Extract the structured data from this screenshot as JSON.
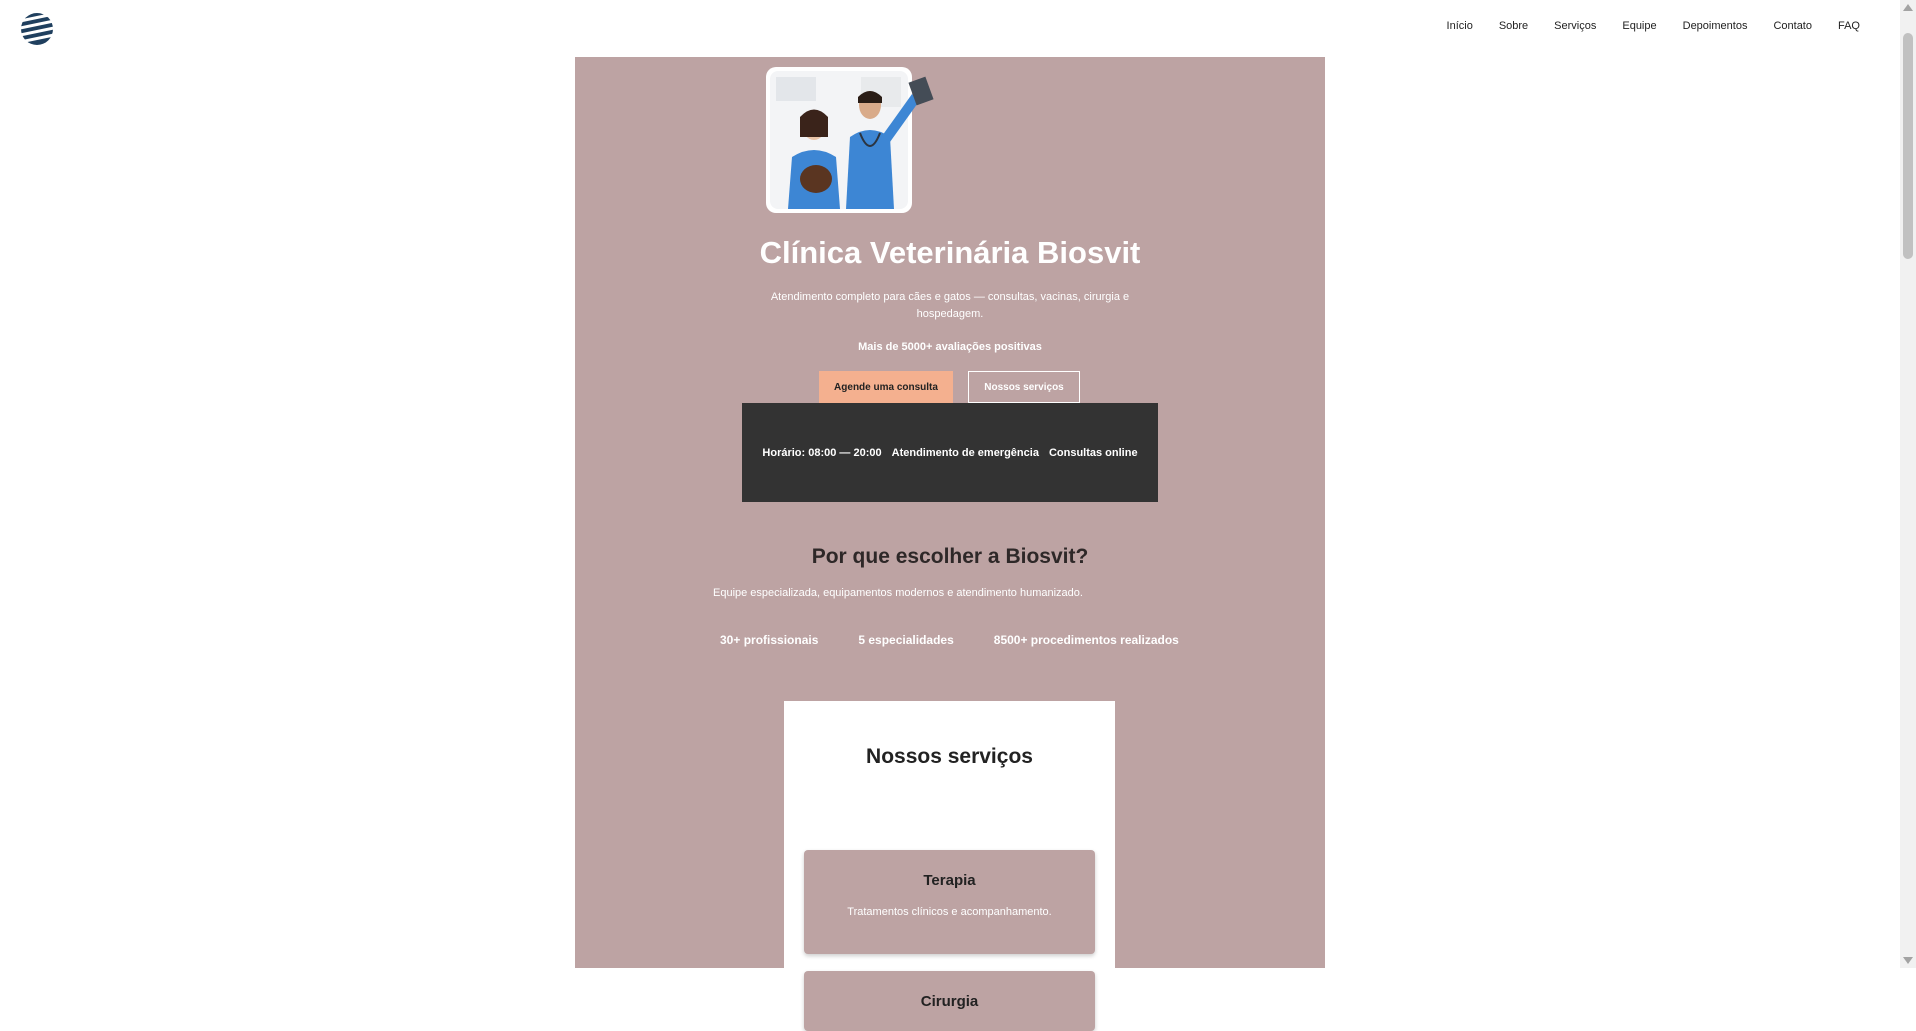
{
  "nav": {
    "items": [
      "Início",
      "Sobre",
      "Serviços",
      "Equipe",
      "Depoimentos",
      "Contato",
      "FAQ"
    ]
  },
  "logo": {
    "icon": "striped-globe-icon",
    "colors": [
      "#1f3f5e",
      "#ffffff"
    ]
  },
  "hero": {
    "title": "Clínica Veterinária Biosvit",
    "subtitle": "Atendimento completo para cães e gatos — consultas, vacinas, cirurgia e hospedagem.",
    "rating": "Mais de 5000+ avaliações positivas",
    "primary_button": "Agende uma consulta",
    "secondary_button": "Nossos serviços"
  },
  "infobar": {
    "items": [
      "Horário: 08:00 — 20:00",
      "Atendimento de emergência",
      "Consultas online"
    ]
  },
  "why": {
    "title": "Por que escolher a Biosvit?",
    "subtitle": "Equipe especializada, equipamentos modernos e atendimento humanizado.",
    "stats": [
      "30+ profissionais",
      "5 especialidades",
      "8500+ procedimentos realizados"
    ]
  },
  "services": {
    "title": "Nossos serviços",
    "cards": [
      {
        "title": "Terapia",
        "desc": "Tratamentos clínicos e acompanhamento."
      },
      {
        "title": "Cirurgia",
        "desc": ""
      }
    ]
  },
  "colors": {
    "main_bg": "#bda3a3",
    "primary_button": "#f4b08f",
    "infobar_bg": "#333333",
    "scrubs": "#3d86d4"
  }
}
